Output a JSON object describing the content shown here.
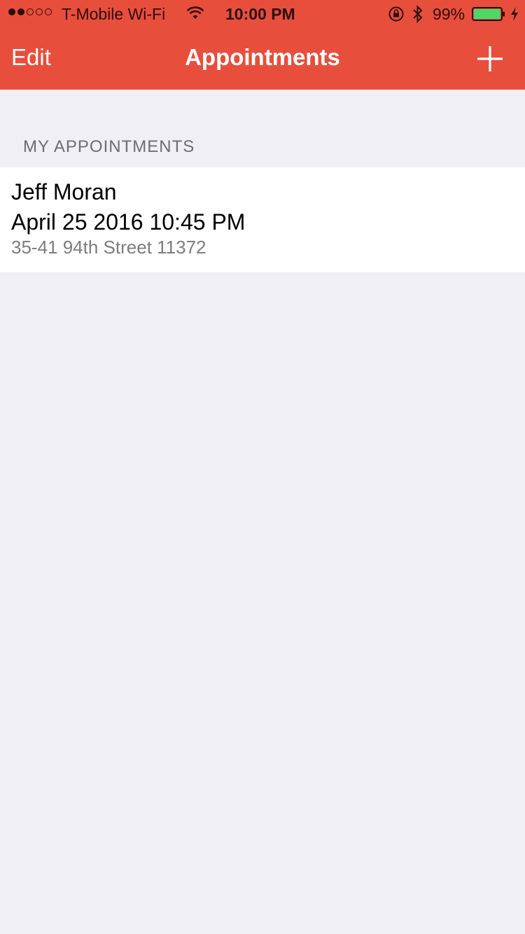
{
  "status_bar": {
    "signal_bars_filled": 2,
    "signal_bars_total": 5,
    "carrier": "T-Mobile Wi-Fi",
    "time": "10:00 PM",
    "battery_percent": "99%",
    "battery_level": 0.99,
    "icons": [
      "wifi-icon",
      "rotation-lock-icon",
      "bluetooth-icon",
      "battery-icon",
      "charging-icon"
    ]
  },
  "nav": {
    "edit_label": "Edit",
    "title": "Appointments",
    "add_icon": "plus-icon"
  },
  "section": {
    "header": "MY APPOINTMENTS"
  },
  "appointments": [
    {
      "name": "Jeff Moran",
      "datetime": "April 25 2016 10:45 PM",
      "address": "35-41 94th Street 11372"
    }
  ],
  "colors": {
    "accent": "#e84e3c",
    "background": "#efeff4",
    "cell": "#ffffff",
    "battery_fill": "#4cd964"
  }
}
